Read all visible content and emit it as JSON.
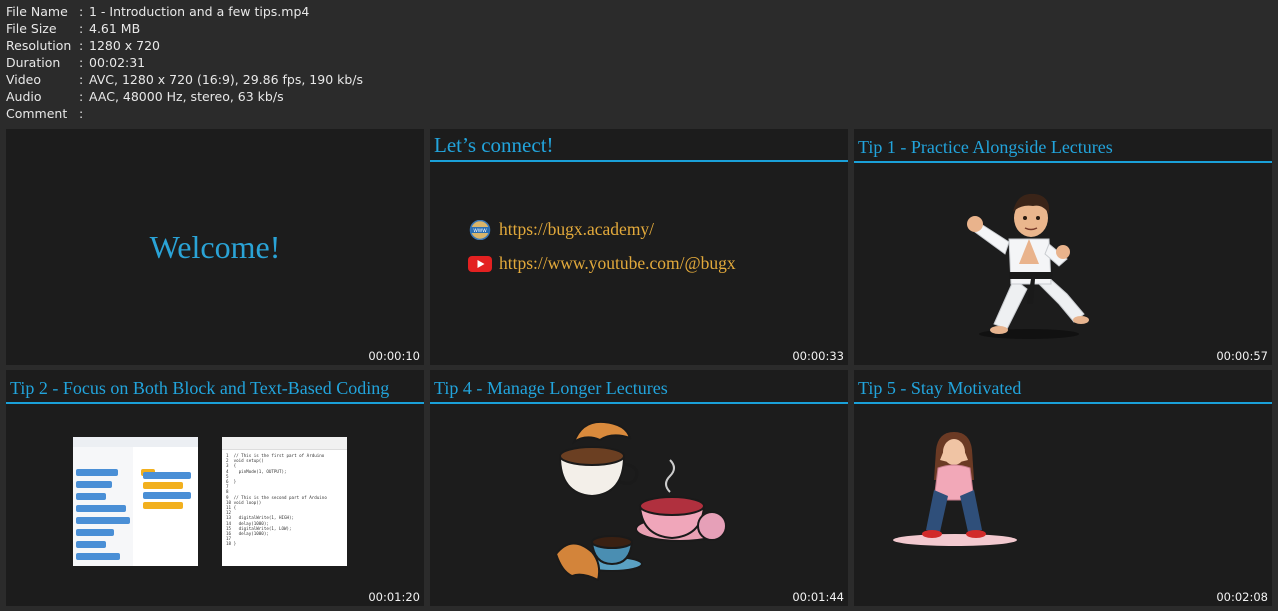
{
  "info": {
    "rows": [
      {
        "key": "File Name",
        "sep": ":",
        "value": "1 - Introduction and a few tips.mp4"
      },
      {
        "key": "File Size",
        "sep": ":",
        "value": "4.61 MB"
      },
      {
        "key": "Resolution",
        "sep": ":",
        "value": "1280 x 720"
      },
      {
        "key": "Duration",
        "sep": ":",
        "value": "00:02:31"
      },
      {
        "key": "Video",
        "sep": ":",
        "value": "AVC, 1280 x 720 (16:9), 29.86 fps, 190 kb/s"
      },
      {
        "key": "Audio",
        "sep": ":",
        "value": "AAC, 48000 Hz, stereo, 63 kb/s"
      },
      {
        "key": "Comment",
        "sep": ":",
        "value": ""
      }
    ]
  },
  "thumbs": [
    {
      "title": "",
      "text": "Welcome!",
      "time": "00:00:10"
    },
    {
      "title": "Let’s connect!",
      "time": "00:00:33",
      "links": [
        {
          "text": "https://bugx.academy/",
          "icon": "globe-www-icon"
        },
        {
          "text": "https://www.youtube.com/@bugx",
          "icon": "youtube-icon"
        }
      ]
    },
    {
      "title": "Tip 1 - Practice Alongside Lectures",
      "time": "00:00:57",
      "image": "karate-kid-illustration"
    },
    {
      "title": "Tip 2 - Focus on Both Block and Text-Based Coding",
      "time": "00:01:20",
      "image": "block-and-text-code-screenshots",
      "code": [
        "1  // This is the first part of Arduino",
        "2  void setup()",
        "3  {",
        "4    pinMode(1, OUTPUT);",
        "5",
        "6  }",
        "7",
        "8",
        "9  // This is the second part of Arduino",
        "10 void loop()",
        "11 {",
        "12",
        "13   digitalWrite(1, HIGH);",
        "14   delay(1000);",
        "15   digitalWrite(1, LOW);",
        "16   delay(1000);",
        "17",
        "18 }"
      ]
    },
    {
      "title": "Tip 4 - Manage Longer Lectures",
      "time": "00:01:44",
      "image": "coffee-and-croissants-illustration"
    },
    {
      "title": "Tip 5 - Stay Motivated",
      "time": "00:02:08",
      "image": "sad-girl-illustration"
    }
  ],
  "colors": {
    "accent": "#22a4dc",
    "link": "#e2a93b",
    "background": "#2b2b2b",
    "thumb_bg": "#1c1c1c"
  }
}
